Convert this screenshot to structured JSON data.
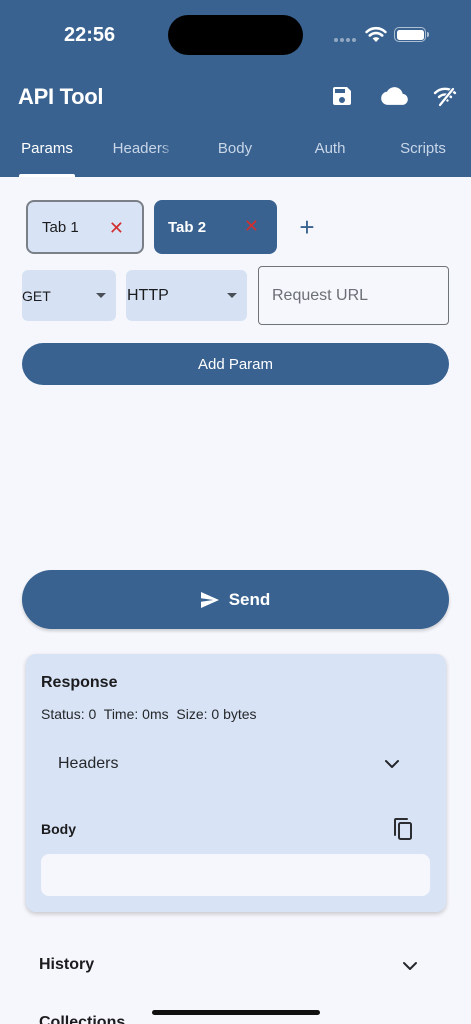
{
  "status_bar": {
    "time": "22:56"
  },
  "app_bar": {
    "title": "API Tool",
    "actions": [
      "save-icon",
      "cloud-icon",
      "wifi-sync-icon"
    ]
  },
  "tabs": [
    {
      "label": "Params",
      "active": true
    },
    {
      "label": "Headers",
      "active": false
    },
    {
      "label": "Body",
      "active": false
    },
    {
      "label": "Auth",
      "active": false
    },
    {
      "label": "Scripts",
      "active": false
    }
  ],
  "request_tabs": [
    {
      "label": "Tab 1",
      "close": "✕"
    },
    {
      "label": "Tab 2",
      "close": "✕"
    }
  ],
  "add_tab_label": "+",
  "request": {
    "method": "GET",
    "protocol": "HTTP",
    "url_placeholder": "Request URL",
    "url_value": ""
  },
  "add_param_label": "Add Param",
  "send_label": "Send",
  "response": {
    "title": "Response",
    "stats": "Status: 0  Time: 0ms  Size: 0 bytes",
    "headers_label": "Headers",
    "body_label": "Body",
    "body_value": ""
  },
  "sections": {
    "history": "History",
    "collections": "Collections"
  },
  "colors": {
    "primary": "#396290",
    "surface_tint": "#d8e4f5",
    "background": "#f6f7fc",
    "close_red": "#d32f2f"
  }
}
